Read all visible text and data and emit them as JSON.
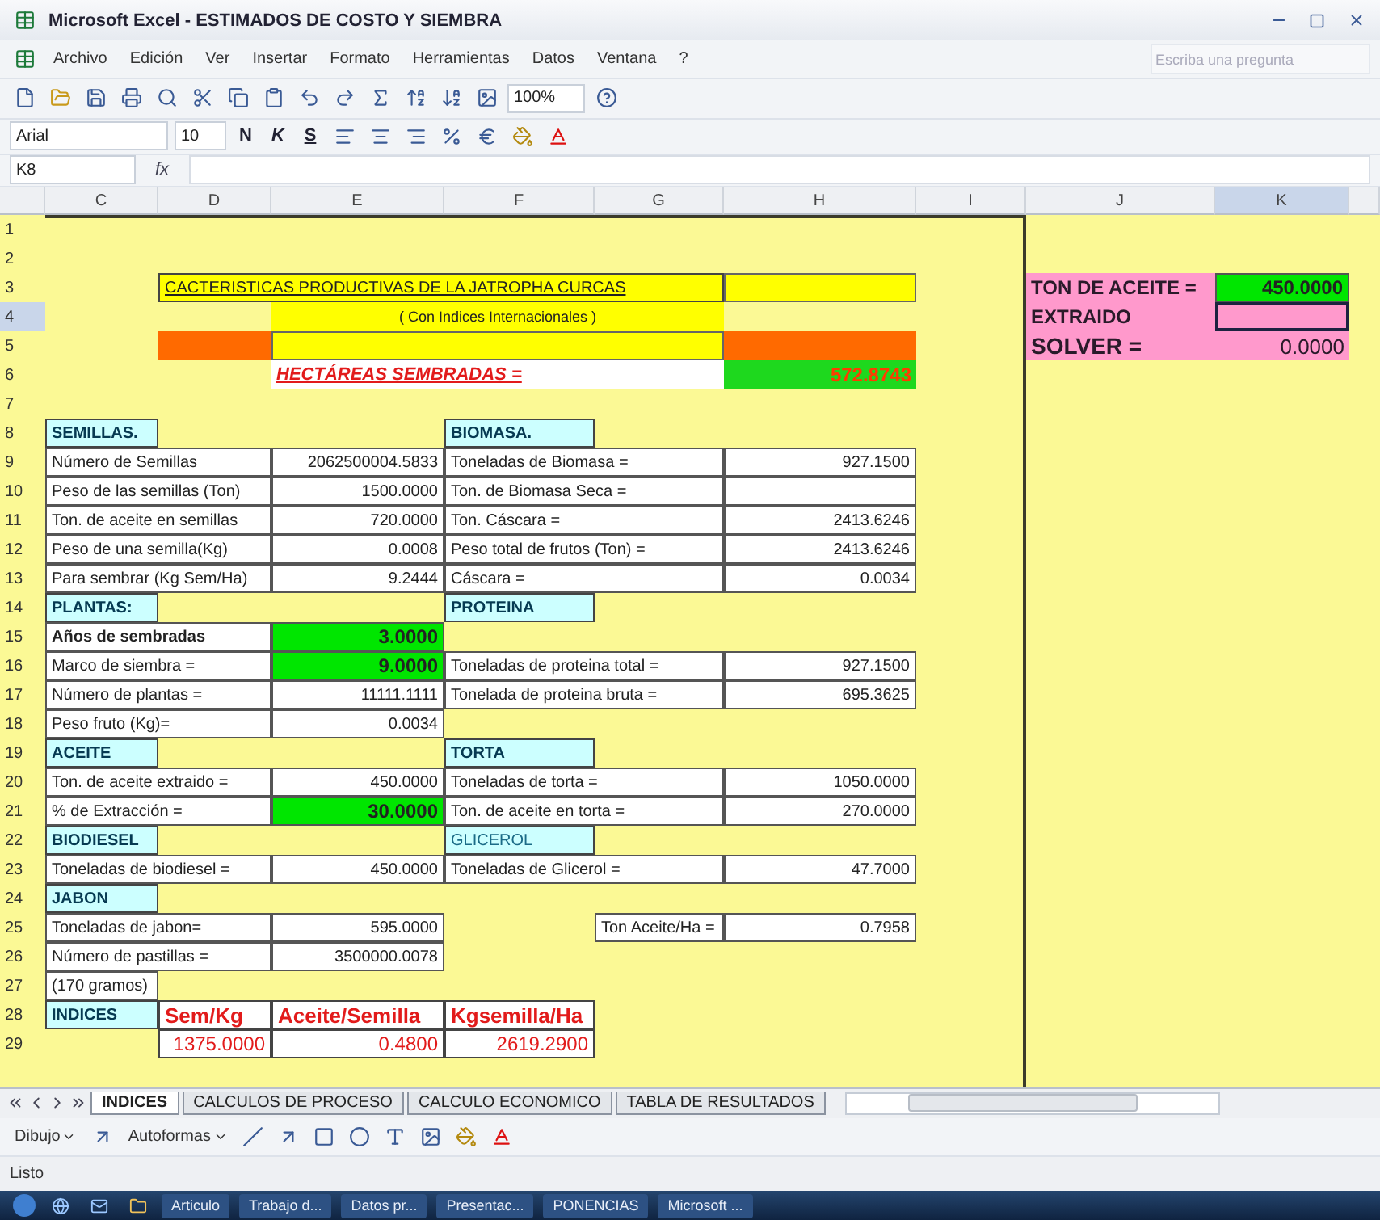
{
  "window": {
    "title": "Microsoft Excel - ESTIMADOS DE COSTO Y SIEMBRA"
  },
  "menu": [
    "Archivo",
    "Edición",
    "Ver",
    "Insertar",
    "Formato",
    "Herramientas",
    "Datos",
    "Ventana",
    "?"
  ],
  "help_field": {
    "placeholder": "Escriba una pregunta"
  },
  "standard_toolbar": {
    "zoom": "100%"
  },
  "format_toolbar": {
    "font": "Arial",
    "size": "10",
    "bold": "N",
    "italic": "K",
    "underline": "S"
  },
  "formula_bar": {
    "name_box": "K8",
    "fx": "fx"
  },
  "columns": [
    {
      "label": "C",
      "selected": false
    },
    {
      "label": "D",
      "selected": false
    },
    {
      "label": "E",
      "selected": false
    },
    {
      "label": "F",
      "selected": false
    },
    {
      "label": "G",
      "selected": false
    },
    {
      "label": "H",
      "selected": false
    },
    {
      "label": "I",
      "selected": false
    },
    {
      "label": "J",
      "selected": false
    },
    {
      "label": "K",
      "selected": true
    }
  ],
  "rows": [
    {
      "n": "1",
      "selected": false,
      "cells": {}
    },
    {
      "n": "2",
      "selected": false,
      "cells": {}
    },
    {
      "n": "3",
      "selected": false,
      "cells": {
        "D": {
          "kind": "title",
          "text": "CACTERISTICAS  PRODUCTIVAS DE LA JATROPHA CURCAS"
        },
        "H": {
          "kind": "box"
        },
        "J": {
          "kind": "pink",
          "text": "TON DE ACEITE ="
        },
        "K": {
          "kind": "green",
          "text": "450.0000"
        }
      }
    },
    {
      "n": "4",
      "selected": true,
      "cells": {
        "E": {
          "kind": "subtitle",
          "text": "( Con Indices Internacionales )"
        },
        "J": {
          "kind": "pink",
          "text": "EXTRAIDO"
        },
        "K": {
          "kind": "pinknum"
        }
      }
    },
    {
      "n": "5",
      "selected": false,
      "cells": {
        "D": {
          "kind": "orange"
        },
        "E": {
          "kind": "band"
        },
        "H": {
          "kind": "orange"
        },
        "J": {
          "kind": "pinkbig",
          "text": "SOLVER ="
        },
        "K": {
          "kind": "pinknum",
          "text": "0.0000"
        }
      }
    },
    {
      "n": "6",
      "selected": false,
      "cells": {
        "E": {
          "kind": "hect",
          "text": "HECTÁREAS SEMBRADAS ="
        },
        "H": {
          "kind": "greenred",
          "text": "572.8743"
        }
      }
    },
    {
      "n": "7",
      "selected": false,
      "cells": {}
    },
    {
      "n": "8",
      "selected": false,
      "cells": {
        "C": {
          "kind": "header",
          "text": "SEMILLAS."
        },
        "F": {
          "kind": "header",
          "text": "BIOMASA."
        }
      }
    },
    {
      "n": "9",
      "selected": false,
      "cells": {
        "C": {
          "kind": "label",
          "text": "Número de Semillas"
        },
        "E": {
          "kind": "num",
          "text": "2062500004.5833"
        },
        "F": {
          "kind": "label",
          "text": "Toneladas de Biomasa ="
        },
        "H": {
          "kind": "num",
          "text": "927.1500"
        }
      }
    },
    {
      "n": "10",
      "selected": false,
      "cells": {
        "C": {
          "kind": "label",
          "text": "Peso de las semillas (Ton)"
        },
        "E": {
          "kind": "num",
          "text": "1500.0000"
        },
        "F": {
          "kind": "label",
          "text": "Ton. de Biomasa Seca ="
        },
        "H": {
          "kind": "num"
        }
      }
    },
    {
      "n": "11",
      "selected": false,
      "cells": {
        "C": {
          "kind": "label",
          "text": "Ton. de aceite en semillas"
        },
        "E": {
          "kind": "num",
          "text": "720.0000"
        },
        "F": {
          "kind": "label",
          "text": "Ton. Cáscara ="
        },
        "H": {
          "kind": "num",
          "text": "2413.6246"
        }
      }
    },
    {
      "n": "12",
      "selected": false,
      "cells": {
        "C": {
          "kind": "label",
          "text": "Peso de una semilla(Kg)"
        },
        "E": {
          "kind": "num",
          "text": "0.0008"
        },
        "F": {
          "kind": "label",
          "text": "Peso total de frutos (Ton) ="
        },
        "H": {
          "kind": "num",
          "text": "2413.6246"
        }
      }
    },
    {
      "n": "13",
      "selected": false,
      "cells": {
        "C": {
          "kind": "label",
          "text": "Para sembrar (Kg Sem/Ha)"
        },
        "E": {
          "kind": "num",
          "text": "9.2444"
        },
        "F": {
          "kind": "label",
          "text": "Cáscara ="
        },
        "H": {
          "kind": "num",
          "text": "0.0034"
        }
      }
    },
    {
      "n": "14",
      "selected": false,
      "cells": {
        "C": {
          "kind": "header",
          "text": "PLANTAS:"
        },
        "F": {
          "kind": "header",
          "text": "PROTEINA"
        }
      }
    },
    {
      "n": "15",
      "selected": false,
      "cells": {
        "C": {
          "kind": "boldlabel",
          "text": "Años de sembradas"
        },
        "E": {
          "kind": "green",
          "text": "3.0000"
        }
      }
    },
    {
      "n": "16",
      "selected": false,
      "cells": {
        "C": {
          "kind": "label",
          "text": "Marco de siembra ="
        },
        "E": {
          "kind": "green",
          "text": "9.0000"
        },
        "F": {
          "kind": "label",
          "text": "Toneladas de proteina total ="
        },
        "H": {
          "kind": "num",
          "text": "927.1500"
        }
      }
    },
    {
      "n": "17",
      "selected": false,
      "cells": {
        "C": {
          "kind": "label",
          "text": "Número de plantas ="
        },
        "E": {
          "kind": "num",
          "text": "11111.1111"
        },
        "F": {
          "kind": "label",
          "text": "Tonelada de proteina bruta ="
        },
        "H": {
          "kind": "num",
          "text": "695.3625"
        }
      }
    },
    {
      "n": "18",
      "selected": false,
      "cells": {
        "C": {
          "kind": "label",
          "text": "Peso fruto (Kg)="
        },
        "E": {
          "kind": "num",
          "text": "0.0034"
        }
      }
    },
    {
      "n": "19",
      "selected": false,
      "cells": {
        "C": {
          "kind": "header",
          "text": "ACEITE"
        },
        "F": {
          "kind": "header",
          "text": "TORTA"
        }
      }
    },
    {
      "n": "20",
      "selected": false,
      "cells": {
        "C": {
          "kind": "label",
          "text": "Ton. de aceite extraido ="
        },
        "E": {
          "kind": "num",
          "text": "450.0000"
        },
        "F": {
          "kind": "label",
          "text": "Toneladas de torta ="
        },
        "H": {
          "kind": "num",
          "text": "1050.0000"
        }
      }
    },
    {
      "n": "21",
      "selected": false,
      "cells": {
        "C": {
          "kind": "label",
          "text": "% de Extracción ="
        },
        "E": {
          "kind": "green",
          "text": "30.0000"
        },
        "F": {
          "kind": "label",
          "text": "Ton. de aceite en torta ="
        },
        "H": {
          "kind": "num",
          "text": "270.0000"
        }
      }
    },
    {
      "n": "22",
      "selected": false,
      "cells": {
        "C": {
          "kind": "header",
          "text": "BIODIESEL"
        },
        "F": {
          "kind": "plainheader",
          "text": "GLICEROL"
        }
      }
    },
    {
      "n": "23",
      "selected": false,
      "cells": {
        "C": {
          "kind": "label",
          "text": "Toneladas de biodiesel ="
        },
        "E": {
          "kind": "num",
          "text": "450.0000"
        },
        "F": {
          "kind": "label",
          "text": "Toneladas de Glicerol ="
        },
        "H": {
          "kind": "num",
          "text": "47.7000"
        }
      }
    },
    {
      "n": "24",
      "selected": false,
      "cells": {
        "C": {
          "kind": "header",
          "text": "JABON"
        }
      }
    },
    {
      "n": "25",
      "selected": false,
      "cells": {
        "C": {
          "kind": "label",
          "text": "Toneladas de jabon="
        },
        "E": {
          "kind": "num",
          "text": "595.0000"
        },
        "G": {
          "kind": "tag",
          "text": "Ton Aceite/Ha ="
        },
        "H": {
          "kind": "num",
          "text": "0.7958"
        }
      }
    },
    {
      "n": "26",
      "selected": false,
      "cells": {
        "C": {
          "kind": "label",
          "text": "Número de pastillas ="
        },
        "E": {
          "kind": "num",
          "text": "3500000.0078"
        }
      }
    },
    {
      "n": "27",
      "selected": false,
      "cells": {
        "C": {
          "kind": "tag",
          "text": "(170 gramos)"
        }
      }
    },
    {
      "n": "28",
      "selected": false,
      "cells": {
        "C": {
          "kind": "header",
          "text": "INDICES"
        },
        "D": {
          "kind": "redhead",
          "text": "Sem/Kg"
        },
        "E": {
          "kind": "redhead",
          "text": "Aceite/Semilla"
        },
        "F": {
          "kind": "redhead",
          "text": "Kgsemilla/Ha"
        }
      }
    },
    {
      "n": "29",
      "selected": false,
      "cells": {
        "D": {
          "kind": "rednum",
          "text": "1375.0000"
        },
        "E": {
          "kind": "rednum",
          "text": "0.4800"
        },
        "F": {
          "kind": "rednum",
          "text": "2619.2900"
        }
      }
    }
  ],
  "sheets": [
    {
      "label": "INDICES",
      "selected": true
    },
    {
      "label": "CALCULOS DE PROCESO",
      "selected": false
    },
    {
      "label": "CALCULO ECONOMICO",
      "selected": false
    },
    {
      "label": "TABLA DE RESULTADOS",
      "selected": false
    }
  ],
  "drawing_toolbar": {
    "draw": "Dibujo",
    "autoshapes": "Autoformas"
  },
  "status_bar": "Listo",
  "taskbar": [
    "Articulo",
    "Trabajo d...",
    "Datos pr...",
    "Presentac...",
    "PONENCIAS",
    "Microsoft ..."
  ]
}
